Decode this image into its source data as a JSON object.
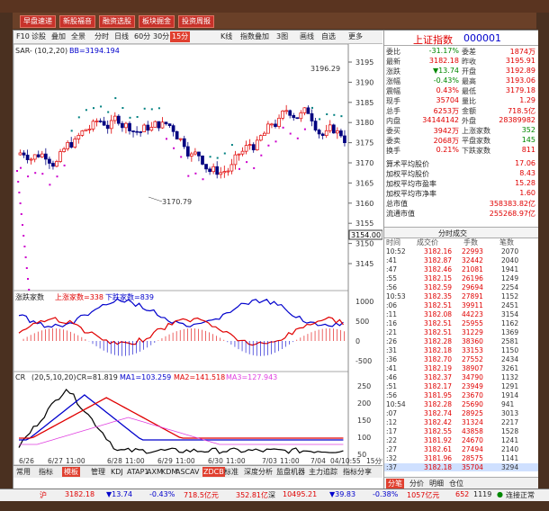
{
  "toolbar": {
    "buttons": [
      "早盘速递",
      "新股福音",
      "融资选股",
      "板块掘金",
      "投资周报"
    ]
  },
  "chart_toolbar": {
    "items": [
      "F10",
      "诊股",
      "叠加",
      "全景",
      "分时",
      "日线",
      "60分",
      "30分",
      "15分",
      "K线",
      "指数叠加",
      "3图",
      "画线",
      "自选",
      "更多"
    ]
  },
  "indicators": {
    "sar_label": "SAR- (10,2,20)",
    "bb_label": "BB=3194.194",
    "volume_label": "涨跌家数",
    "up_label": "上涨家数=338",
    "down_label": "下跌家数=839",
    "cr_label": "CR",
    "cr_params": "(20,5,10,20)",
    "cr_value": "CR=81.819",
    "ma1": "MA1=103.259",
    "ma2": "MA2=141.518",
    "ma3": "MA3=127.943"
  },
  "price_axis": [
    "3195",
    "3190",
    "3185",
    "3180",
    "3175",
    "3170",
    "3165",
    "3160",
    "3155",
    "3150",
    "3145"
  ],
  "price_current": "3154.00",
  "price_high_label": "3196.29",
  "price_low_label": "3170.79",
  "volume_axis": [
    "1000",
    "500",
    "0",
    "-500"
  ],
  "cr_axis": [
    "250",
    "200",
    "150",
    "100",
    "50"
  ],
  "x_axis": [
    "6/26",
    "6/27",
    "11:00",
    "6/28",
    "11:00",
    "6/29",
    "11:00",
    "6/30",
    "11:00",
    "7/03",
    "11:00",
    "7/04",
    "04/10:55",
    "15分钟"
  ],
  "bottom_tabs": [
    "常用",
    "指标",
    "模板",
    "管理",
    "KDJ",
    "ATAP1",
    "AXM",
    "KDM",
    "ASC",
    "AV",
    "ZDCB",
    "标准",
    "深度分析",
    "监盘机器",
    "主力追踪",
    "指标分享"
  ],
  "quote": {
    "title": "上证指数",
    "code": "000001",
    "rows": [
      {
        "l1": "委比",
        "v1": "-31.17%",
        "l2": "委差",
        "v2": "1874万"
      },
      {
        "l1": "最新",
        "v1": "3182.18",
        "l2": "昨收",
        "v2": "3195.91"
      },
      {
        "l1": "涨跌",
        "v1": "▼13.74",
        "l2": "开盘",
        "v2": "3192.89"
      },
      {
        "l1": "涨幅",
        "v1": "-0.43%",
        "l2": "最高",
        "v2": "3193.06"
      },
      {
        "l1": "震幅",
        "v1": "0.43%",
        "l2": "最低",
        "v2": "3179.18"
      },
      {
        "l1": "现手",
        "v1": "35704",
        "l2": "量比",
        "v2": "1.29"
      },
      {
        "l1": "总手",
        "v1": "6253万",
        "l2": "金额",
        "v2": "718.5亿"
      },
      {
        "l1": "内盘",
        "v1": "34144142",
        "l2": "外盘",
        "v2": "28389982"
      },
      {
        "l1": "委买",
        "v1": "3942万",
        "l2": "上涨家数",
        "v2": "352"
      },
      {
        "l1": "委卖",
        "v1": "2068万",
        "l2": "平盘家数",
        "v2": "145"
      },
      {
        "l1": "换手",
        "v1": "0.21%",
        "l2": "下跌家数",
        "v2": "811"
      }
    ],
    "stats": [
      {
        "l": "算术平均股价",
        "v": "17.06"
      },
      {
        "l": "加权平均股价",
        "v": "8.43"
      },
      {
        "l": "加权平均市盈率",
        "v": "15.28"
      },
      {
        "l": "加权平均市净率",
        "v": "1.60"
      },
      {
        "l": "总市值",
        "v": "358383.82亿"
      },
      {
        "l": "流通市值",
        "v": "255268.97亿"
      }
    ]
  },
  "trades": {
    "tab": "分时成交",
    "headers": [
      "时间",
      "成交价",
      "手数",
      "笔数"
    ],
    "rows": [
      [
        "10:52",
        "3182.16",
        "22993",
        "2070"
      ],
      [
        ":41",
        "3182.87",
        "32442",
        "2040"
      ],
      [
        ":47",
        "3182.46",
        "21081",
        "1941"
      ],
      [
        ":55",
        "3182.15",
        "26196",
        "1249"
      ],
      [
        ":56",
        "3182.59",
        "29694",
        "2254"
      ],
      [
        "10:53",
        "3182.35",
        "27891",
        "1152"
      ],
      [
        ":06",
        "3182.51",
        "39911",
        "2451"
      ],
      [
        ":11",
        "3182.08",
        "44223",
        "3154"
      ],
      [
        ":16",
        "3182.51",
        "25955",
        "1162"
      ],
      [
        ":21",
        "3182.51",
        "31229",
        "1369"
      ],
      [
        ":26",
        "3182.28",
        "38360",
        "2581"
      ],
      [
        ":31",
        "3182.18",
        "33153",
        "1150"
      ],
      [
        ":36",
        "3182.70",
        "27552",
        "2434"
      ],
      [
        ":41",
        "3182.19",
        "38907",
        "3261"
      ],
      [
        ":46",
        "3182.37",
        "34790",
        "1132"
      ],
      [
        ":51",
        "3182.17",
        "23949",
        "1291"
      ],
      [
        ":56",
        "3181.95",
        "23670",
        "1914"
      ],
      [
        "10:54",
        "3182.28",
        "25690",
        "941"
      ],
      [
        ":07",
        "3182.74",
        "28925",
        "3013"
      ],
      [
        ":12",
        "3182.42",
        "31324",
        "2217"
      ],
      [
        ":17",
        "3182.55",
        "43858",
        "1528"
      ],
      [
        ":22",
        "3181.92",
        "24670",
        "1241"
      ],
      [
        ":27",
        "3182.61",
        "27494",
        "2140"
      ],
      [
        ":32",
        "3181.96",
        "28575",
        "1141"
      ],
      [
        ":37",
        "3182.18",
        "35704",
        "3294"
      ]
    ],
    "bottom_tabs": [
      "分笔",
      "分价",
      "明细",
      "仓位"
    ]
  },
  "status": {
    "index_name": "沪",
    "price": "3182.18",
    "change": "▼13.74",
    "pct": "-0.43%",
    "amount": "718.5亿元",
    "val2": "352.81亿",
    "shenzhen": "深",
    "sz_price": "10495.21",
    "sz_change": "▼39.83",
    "sz_pct": "-0.38%",
    "sz_amount": "1057亿元",
    "sz_val2": "652",
    "sz_val3": "1119",
    "conn": "连接正常"
  },
  "colors": {
    "up": "#e00000",
    "down": "#000080",
    "accent": "#c8322a"
  }
}
